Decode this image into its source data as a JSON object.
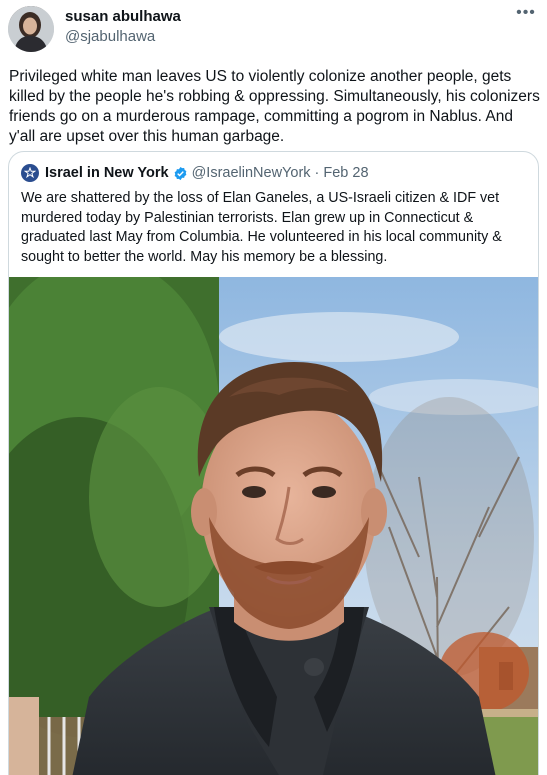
{
  "tweet": {
    "author_name": "susan abulhawa",
    "author_handle": "@sjabulhawa",
    "more_icon": "more-horizontal-icon",
    "text": "Privileged white man leaves US to violently colonize another people, gets killed by the people he's robbing & oppressing. Simultaneously, his colonizers friends go on a murderous rampage, committing a pogrom in Nablus. And y'all are upset over this human garbage."
  },
  "quoted_tweet": {
    "author_name": "Israel in New York",
    "author_handle": "@IsraelinNewYork",
    "separator": "·",
    "date": "Feb 28",
    "verified_icon": "verified-badge-icon",
    "text": "We are shattered by the loss of Elan Ganeles, a US-Israeli citizen & IDF vet murdered today by Palestinian terrorists. Elan grew up in Connecticut & graduated last May from Columbia. He volunteered in his local community & sought to better the world. May his memory be a blessing."
  },
  "colors": {
    "text_primary": "#0f1419",
    "text_secondary": "#536471",
    "border": "#cfd9de",
    "verified_blue": "#1d9bf0"
  }
}
